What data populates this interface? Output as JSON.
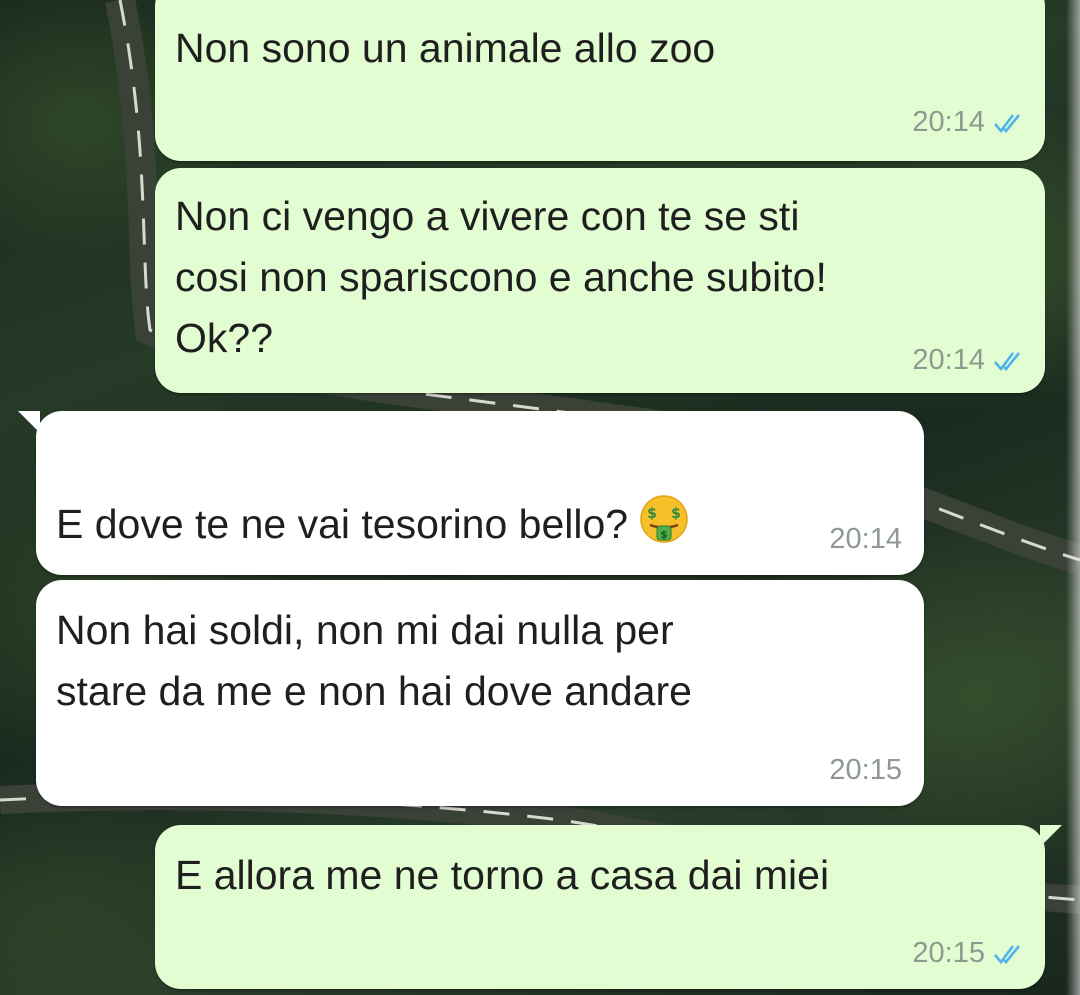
{
  "messages": [
    {
      "direction": "out",
      "text": "Non sono un animale allo zoo",
      "time": "20:14",
      "read_ticks": "double-check-blue-icon"
    },
    {
      "direction": "out",
      "text": "Non ci vengo a vivere con te se sti\ncosi non spariscono e anche subito!\nOk??",
      "time": "20:14",
      "read_ticks": "double-check-blue-icon"
    },
    {
      "direction": "in",
      "text": "E dove te ne vai tesorino bello?",
      "emoji": "money-mouth-face-icon",
      "time": "20:14"
    },
    {
      "direction": "in",
      "text": "Non hai soldi, non mi dai nulla per\nstare da me e non hai dove andare",
      "time": "20:15"
    },
    {
      "direction": "out",
      "text": "E allora me ne torno a casa dai miei",
      "time": "20:15",
      "read_ticks": "double-check-blue-icon"
    }
  ],
  "colors": {
    "outgoing_bubble": "#e2fdd2",
    "incoming_bubble": "#ffffff",
    "timestamp": "#8e9a90",
    "read_tick": "#4fb3ec"
  }
}
